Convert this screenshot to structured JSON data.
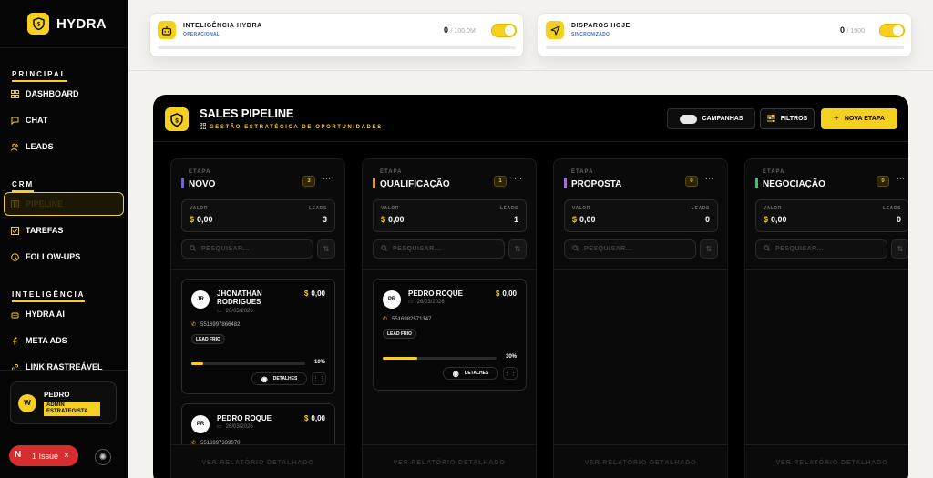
{
  "brand": {
    "name": "HYDRA"
  },
  "sidebar": {
    "sections": [
      {
        "title": "PRINCIPAL",
        "items": [
          {
            "label": "DASHBOARD",
            "icon": "grid-icon"
          },
          {
            "label": "CHAT",
            "icon": "chat-icon"
          },
          {
            "label": "LEADS",
            "icon": "users-icon"
          }
        ]
      },
      {
        "title": "CRM",
        "items": [
          {
            "label": "PIPELINE",
            "icon": "kanban-icon",
            "active": true
          },
          {
            "label": "TAREFAS",
            "icon": "check-square-icon"
          },
          {
            "label": "FOLLOW-UPS",
            "icon": "clock-icon"
          }
        ]
      },
      {
        "title": "INTELIGÊNCIA",
        "items": [
          {
            "label": "HYDRA AI",
            "icon": "robot-icon"
          },
          {
            "label": "META ADS",
            "icon": "meta-icon"
          },
          {
            "label": "LINK RASTREÁVEL",
            "icon": "link-icon"
          }
        ]
      }
    ],
    "user": {
      "initial": "W",
      "name": "PEDRO",
      "role": "ADMIN ESTRATEGISTA"
    },
    "issue": {
      "badge": "N",
      "label": "1 Issue",
      "close": "×"
    }
  },
  "topcards": [
    {
      "title": "INTELIGÊNCIA HYDRA",
      "subtitle": "OPERACIONAL",
      "value": "0",
      "max": "/ 100.0M",
      "enabled": true
    },
    {
      "title": "DISPAROS HOJE",
      "subtitle": "SINCRONIZADO",
      "value": "0",
      "max": "/ 1000",
      "enabled": true
    }
  ],
  "board": {
    "title": "SALES PIPELINE",
    "subtitle": "GESTÃO ESTRATÉGICA DE OPORTUNIDADES",
    "buttons": {
      "campaigns": "CAMPANHAS",
      "filters": "FILTROS",
      "new_stage": "NOVA ETAPA"
    },
    "columns": [
      {
        "label": "ETAPA",
        "name": "NOVO",
        "count": "3",
        "color": "#6a5cff",
        "valor_label": "VALOR",
        "valor": "0,00",
        "leads_label": "LEADS",
        "leads": "3",
        "search": "PESQUISAR...",
        "footer": "VER RELATÓRIO DETALHADO"
      },
      {
        "label": "ETAPA",
        "name": "QUALIFICAÇÃO",
        "count": "1",
        "color": "#ff8a1e",
        "valor_label": "VALOR",
        "valor": "0,00",
        "leads_label": "LEADS",
        "leads": "1",
        "search": "PESQUISAR...",
        "footer": "VER RELATÓRIO DETALHADO"
      },
      {
        "label": "ETAPA",
        "name": "PROPOSTA",
        "count": "0",
        "color": "#b05cff",
        "valor_label": "VALOR",
        "valor": "0,00",
        "leads_label": "LEADS",
        "leads": "0",
        "search": "PESQUISAR...",
        "footer": "VER RELATÓRIO DETALHADO"
      },
      {
        "label": "ETAPA",
        "name": "NEGOCIAÇÃO",
        "count": "0",
        "color": "#2ecc71",
        "valor_label": "VALOR",
        "valor": "0,00",
        "leads_label": "LEADS",
        "leads": "0",
        "search": "PESQUISAR...",
        "footer": "VER RELATÓRIO DETALHADO"
      }
    ],
    "leads": [
      {
        "initials": "JR",
        "name": "JHONATHAN RODRIGUES",
        "date": "26/03/2026",
        "amount": "0,00",
        "phone": "5516997866482",
        "tag": "LEAD FRIO",
        "progress": 10,
        "progress_label": "10%",
        "details": "DETALHES"
      },
      {
        "initials": "PR",
        "name": "PEDRO ROQUE",
        "date": "26/03/2026",
        "amount": "0,00",
        "phone": "5516997339070"
      },
      {
        "initials": "PR",
        "name": "PEDRO ROQUE",
        "date": "26/03/2026",
        "amount": "0,00",
        "phone": "5516982571347",
        "tag": "LEAD FRIO",
        "progress": 30,
        "progress_label": "30%",
        "details": "DETALHES"
      }
    ]
  }
}
